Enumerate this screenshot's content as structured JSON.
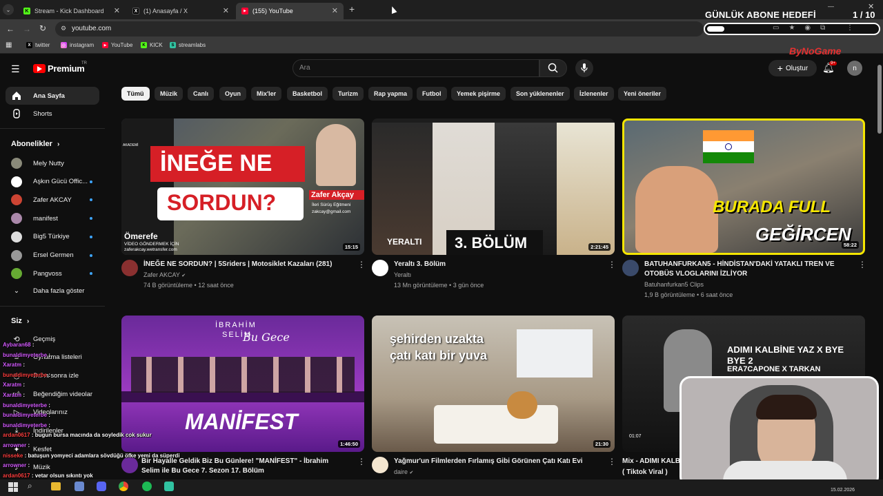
{
  "browser": {
    "tabs": [
      {
        "title": "Stream - Kick Dashboard",
        "favicon": "kick-icon",
        "active": false
      },
      {
        "title": "(1) Anasayfa / X",
        "favicon": "x-icon",
        "active": false
      },
      {
        "title": "(155) YouTube",
        "favicon": "youtube-icon",
        "active": true
      }
    ],
    "url": "youtube.com",
    "bookmarks": [
      {
        "label": "twitter",
        "icon": "x-icon"
      },
      {
        "label": "instagram",
        "icon": "instagram-icon"
      },
      {
        "label": "YouTube",
        "icon": "youtube-icon"
      },
      {
        "label": "KICK",
        "icon": "kick-icon"
      },
      {
        "label": "streamlabs",
        "icon": "streamlabs-icon"
      }
    ]
  },
  "overlay": {
    "goal_title": "GÜNLÜK ABONE HEDEFİ",
    "goal_count": "1 / 10",
    "goal_progress": 0.1,
    "brand": "ByNoGame"
  },
  "youtube": {
    "logo_text": "Premium",
    "logo_suffix": "TR",
    "search_placeholder": "Ara",
    "create_label": "Oluştur",
    "notif_badge": "9+",
    "avatar_letter": "n",
    "sidebar": {
      "main": [
        {
          "label": "Ana Sayfa",
          "icon": "home-icon",
          "active": true
        },
        {
          "label": "Shorts",
          "icon": "shorts-icon",
          "active": false
        }
      ],
      "subs_header": "Abonelikler",
      "subscriptions": [
        {
          "label": "Mely Nutty",
          "live": false,
          "color": "#8a8a7a"
        },
        {
          "label": "Aşkın Gücü Offic...",
          "live": true,
          "color": "#ffffff"
        },
        {
          "label": "Zafer AKCAY",
          "live": true,
          "color": "#c43"
        },
        {
          "label": "manifest",
          "live": true,
          "color": "#a8a"
        },
        {
          "label": "Big5 Türkiye",
          "live": true,
          "color": "#ddd"
        },
        {
          "label": "Ersel Germen",
          "live": true,
          "color": "#999"
        },
        {
          "label": "Pangvoss",
          "live": true,
          "color": "#6a3"
        }
      ],
      "show_more": "Daha fazla göster",
      "you_header": "Siz",
      "you_items": [
        "Geçmiş",
        "Oynatma listeleri",
        "Daha sonra izle",
        "Beğendiğim videolar",
        "Videolarınız",
        "İndirilenler",
        "Kesfet",
        "Müzik"
      ]
    },
    "chips": [
      "Tümü",
      "Müzik",
      "Canlı",
      "Oyun",
      "Mix'ler",
      "Basketbol",
      "Turizm",
      "Rap yapma",
      "Futbol",
      "Yemek pişirme",
      "Son yüklenenler",
      "İzlenenler",
      "Yeni öneriler"
    ],
    "videos": [
      {
        "title": "İNEĞE NE SORDUN? | 5Sriders | Motosiklet Kazaları (281)",
        "channel": "Zafer AKCAY",
        "verified": true,
        "meta": "74 B görüntüleme • 12 saat önce",
        "duration": "15:15",
        "thumb_text": [
          "İNEĞE NE",
          "SORDUN?"
        ],
        "thumb_sub": [
          "Zafer Akçay",
          "İleri Sürüş Eğitmeni",
          "zakcay@gmail.com",
          "Ömerefe",
          "VİDEO GÖNDERMEK İÇİN",
          "zaferakcay.wetransfer.com",
          "AKADEMİ"
        ]
      },
      {
        "title": "Yeraltı 3. Bölüm",
        "channel": "Yeraltı",
        "verified": false,
        "meta": "13 Mn görüntüleme • 3 gün önce",
        "duration": "2:21:45",
        "thumb_text": [
          "3. BÖLÜM",
          "YERALTI"
        ]
      },
      {
        "title": "BATUHANFURKAN5 - HİNDİSTAN'DAKİ YATAKLI TREN VE OTOBÜS VLOGLARINI İZLİYOR",
        "channel": "Batuhanfurkan5 Clips",
        "verified": false,
        "meta": "1,9 B görüntüleme • 6 saat önce",
        "duration": "58:22",
        "thumb_text": [
          "BURADA FULL",
          "GEĞİRCEN"
        ]
      },
      {
        "title": "Bir Hayalle Geldik Biz Bu Günlere! \"MANİFEST\" - İbrahim Selim ile Bu Gece 7. Sezon 17. Bölüm",
        "channel": "",
        "verified": false,
        "meta": "",
        "duration": "1:46:50",
        "thumb_text": [
          "İBRAHİM",
          "SELİM",
          "Bu Gece",
          "MANİFEST"
        ]
      },
      {
        "title": "Yağmur'un Filmlerden Fırlamış Gibi Görünen Çatı Katı Evi",
        "channel": "daire",
        "verified": true,
        "meta": "",
        "duration": "21:30",
        "thumb_text": [
          "şehirden uzakta",
          "çatı katı bir yuva"
        ]
      },
      {
        "title": "Mix - ADIMI KALB",
        "channel": "( Tiktok Viral )",
        "verified": false,
        "meta": "",
        "duration": "01:07",
        "thumb_text": [
          "ADIMI KALBİNE YAZ X BYE BYE 2",
          "ERA7CAPONE X TARKAN"
        ]
      }
    ]
  },
  "chat": [
    {
      "user": "Aybaran68",
      "msg": "",
      "red": false
    },
    {
      "user": "bunaldimyeterbe",
      "msg": "",
      "red": false
    },
    {
      "user": "Xaratm",
      "msg": "",
      "red": false
    },
    {
      "user": "bunaldimyeterbe",
      "msg": "",
      "red": true
    },
    {
      "user": "Xaratm",
      "msg": "",
      "red": false
    },
    {
      "user": "Xaratm",
      "msg": "",
      "red": false
    },
    {
      "user": "bunaldimyeterbe",
      "msg": "",
      "red": false
    },
    {
      "user": "bunaldimyeterbe",
      "msg": "",
      "red": false
    },
    {
      "user": "bunaldimyeterbe",
      "msg": "",
      "red": false
    },
    {
      "user": "ardan0617",
      "msg": "bugun bursa macında da soyledik cok sukur",
      "red": true
    },
    {
      "user": "arrowner",
      "msg": "",
      "red": false
    },
    {
      "user": "nisseke",
      "msg": "batuşun yomyeci adamlara sövdüğü öfke yemi da süperdi",
      "red": true
    },
    {
      "user": "arrowner",
      "msg": "",
      "red": false
    },
    {
      "user": "ardan0617",
      "msg": "vetar olsun sıkıntı yok",
      "red": true
    }
  ],
  "taskbar": {
    "date": "15.02.2026"
  }
}
